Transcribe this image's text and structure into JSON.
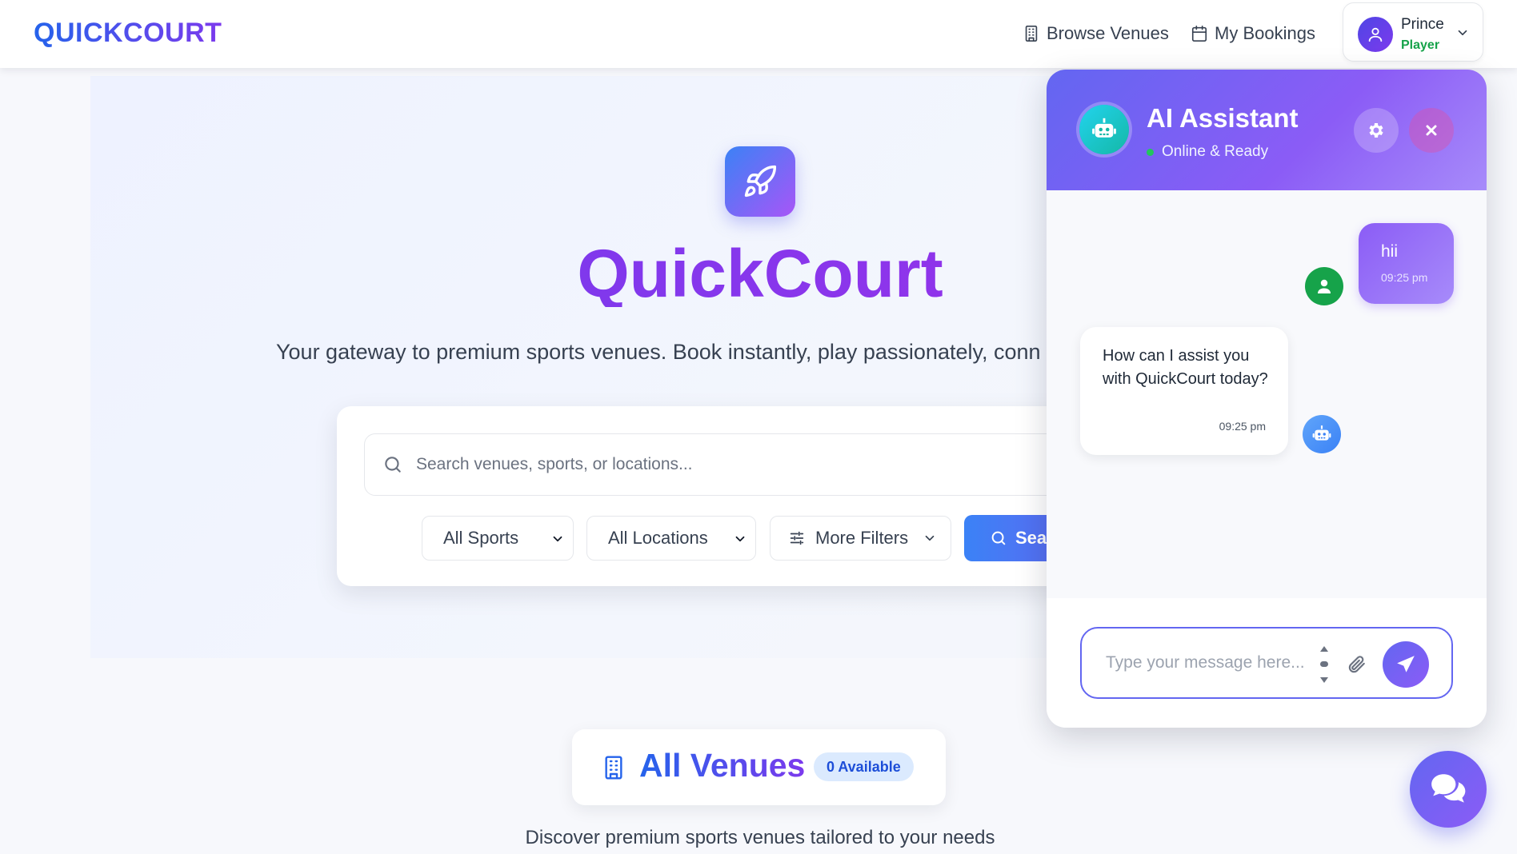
{
  "navbar": {
    "brand": "QUICKCOURT",
    "links": [
      {
        "label": "Browse Venues",
        "icon": "building-icon"
      },
      {
        "label": "My Bookings",
        "icon": "calendar-icon"
      }
    ],
    "user": {
      "name": "Prince",
      "role": "Player"
    }
  },
  "hero": {
    "icon": "rocket-icon",
    "title": "QuickCourt",
    "subtitle": "Your gateway to premium sports venues. Book instantly, play passionately, conn",
    "search": {
      "placeholder": "Search venues, sports, or locations...",
      "sports_select": "All Sports",
      "locations_select": "All Locations",
      "filters_label": "More Filters",
      "search_button": "Sea"
    }
  },
  "venues": {
    "title": "All Venues",
    "badge": "0 Available",
    "subtitle": "Discover premium sports venues tailored to your needs"
  },
  "chat": {
    "title": "AI Assistant",
    "status": "Online & Ready",
    "messages": [
      {
        "from": "user",
        "text": "hii",
        "time": "09:25 pm"
      },
      {
        "from": "bot",
        "text": "How can I assist you with QuickCourt today?",
        "time": "09:25 pm"
      }
    ],
    "input_placeholder": "Type your message here..."
  },
  "colors": {
    "brand_blue": "#2563eb",
    "brand_purple": "#7c3aed",
    "online": "#22c55e",
    "role_green": "#16a34a"
  }
}
